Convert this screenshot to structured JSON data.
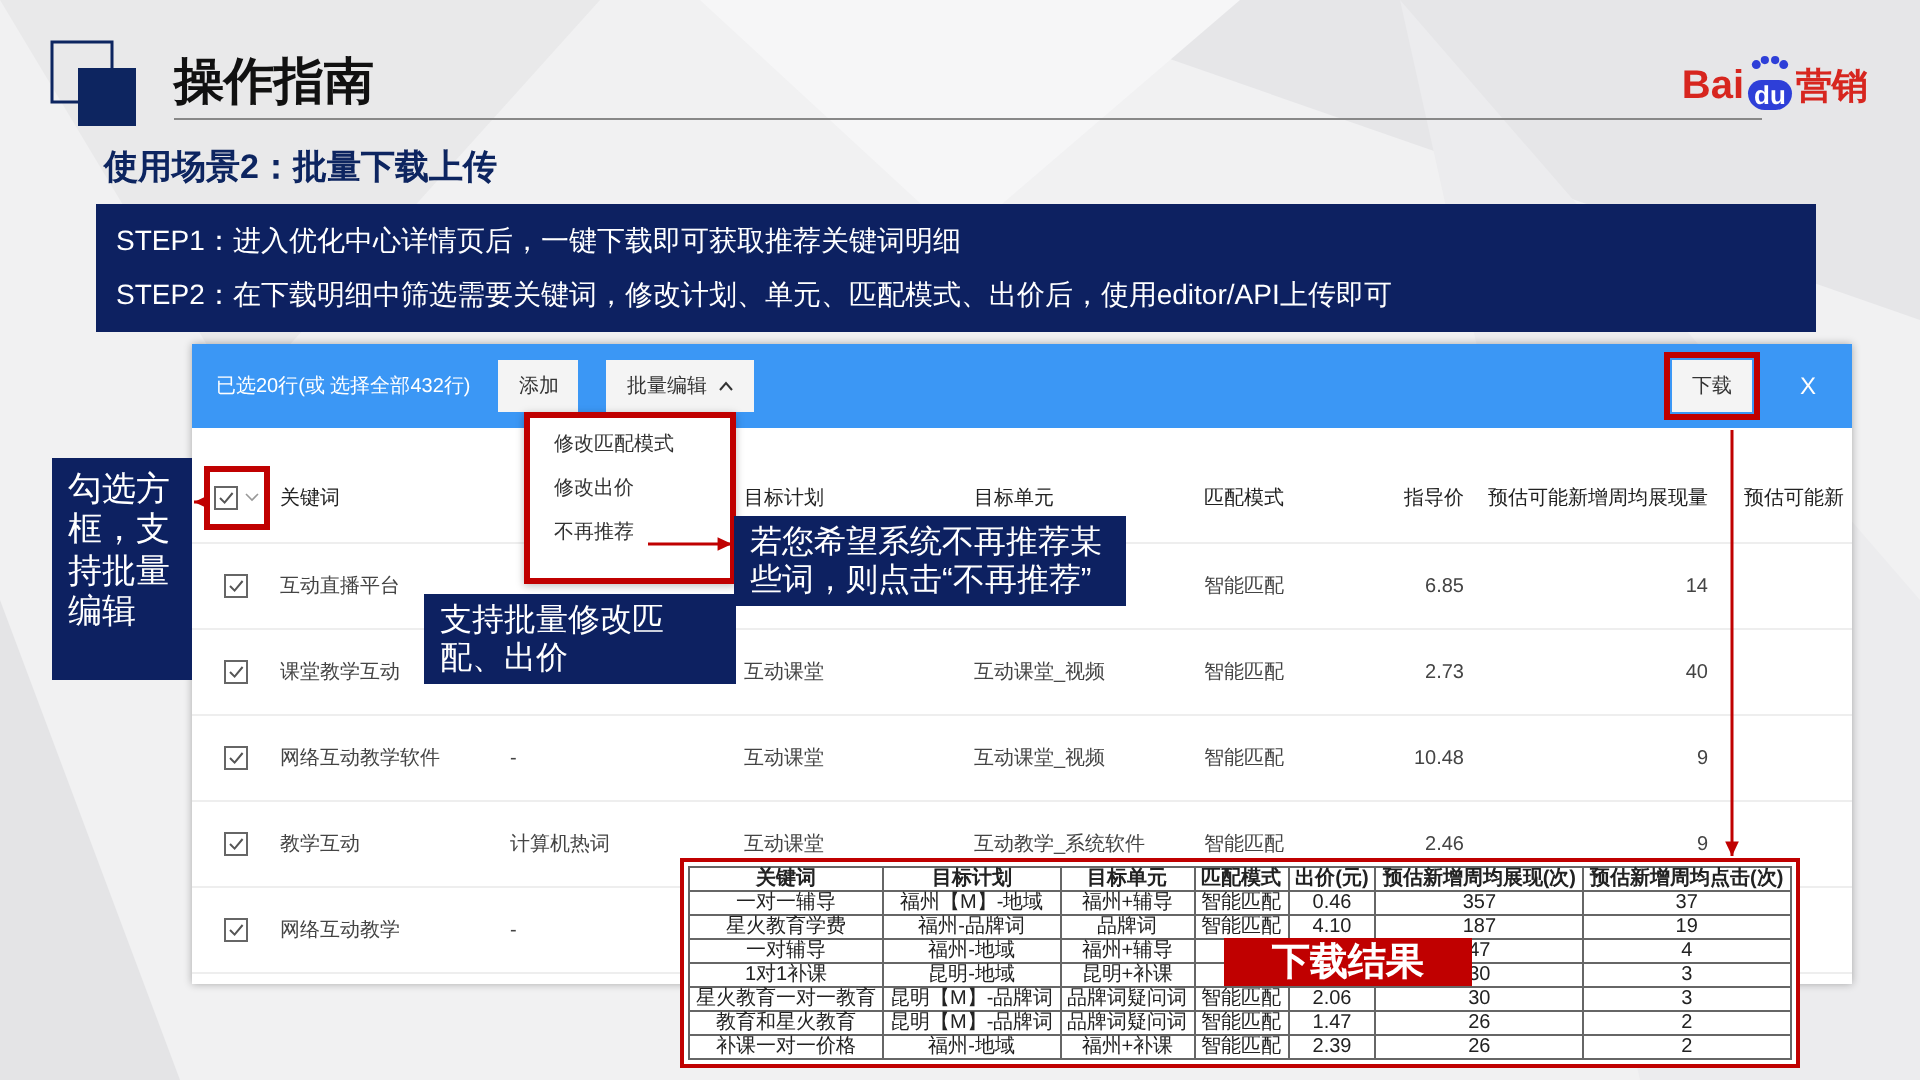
{
  "header": {
    "title": "操作指南",
    "logo": {
      "left": "Bai",
      "paw": "du",
      "right": "营销"
    }
  },
  "subtitle": "使用场景2：批量下载上传",
  "steps": [
    "STEP1：进入优化中心详情页后，一键下载即可获取推荐关键词明细",
    "STEP2：在下载明细中筛选需要关键词，修改计划、单元、匹配模式、出价后，使用editor/API上传即可"
  ],
  "app": {
    "toolbar": {
      "selection": "已选20行(或 选择全部432行)",
      "buttons": [
        {
          "label": "添加",
          "kind": "plain"
        },
        {
          "label": "批量编辑",
          "kind": "dropdown",
          "expanded": true
        }
      ],
      "download": "下载",
      "close": "X"
    },
    "menu": [
      "修改匹配模式",
      "修改出价",
      "不再推荐"
    ],
    "table": {
      "all_checked": true,
      "columns": [
        "关键词",
        null,
        "目标计划",
        "目标单元",
        "匹配模式",
        "指导价",
        "预估可能新增周均展现量",
        "预估可能新"
      ],
      "rows": [
        {
          "checked": true,
          "cells": [
            "互动直播平台",
            null,
            null,
            null,
            "智能匹配",
            "6.85",
            "14",
            null
          ]
        },
        {
          "checked": true,
          "cells": [
            "课堂教学互动",
            null,
            "互动课堂",
            "互动课堂_视频",
            "智能匹配",
            "2.73",
            "40",
            null
          ]
        },
        {
          "checked": true,
          "cells": [
            "网络互动教学软件",
            "-",
            "互动课堂",
            "互动课堂_视频",
            "智能匹配",
            "10.48",
            "9",
            null
          ]
        },
        {
          "checked": true,
          "cells": [
            "教学互动",
            "计算机热词",
            "互动课堂",
            "互动教学_系统软件",
            "智能匹配",
            "2.46",
            "9",
            null
          ]
        },
        {
          "checked": true,
          "cells": [
            "网络互动教学",
            "-",
            null,
            null,
            null,
            null,
            null,
            null
          ]
        }
      ]
    }
  },
  "callouts": [
    {
      "kind": "checkbox",
      "text": "勾选方框，支持批量编辑"
    },
    {
      "kind": "menu",
      "text": "支持批量修改匹配、出价"
    },
    {
      "kind": "remove",
      "text": "若您希望系统不再推荐某些词，则点击“不再推荐”"
    }
  ],
  "result": {
    "label": "下载结果",
    "columns": [
      "关键词",
      "目标计划",
      "目标单元",
      "匹配模式",
      "出价(元)",
      "预估新增周均展现(次)",
      "预估新增周均点击(次)"
    ],
    "rows": [
      [
        "一对一辅导",
        "福州【M】-地域",
        "福州+辅导",
        "智能匹配",
        "0.46",
        "357",
        "37"
      ],
      [
        "星火教育学费",
        "福州-品牌词",
        "品牌词",
        "智能匹配",
        "4.10",
        "187",
        "19"
      ],
      [
        "一对辅导",
        "福州-地域",
        "福州+辅导",
        null,
        null,
        "47",
        "4"
      ],
      [
        "1对1补课",
        "昆明-地域",
        "昆明+补课",
        null,
        null,
        "30",
        "3"
      ],
      [
        "星火教育一对一教育",
        "昆明【M】-品牌词",
        "品牌词疑问词",
        "智能匹配",
        "2.06",
        "30",
        "3"
      ],
      [
        "教育和星火教育",
        "昆明【M】-品牌词",
        "品牌词疑问词",
        "智能匹配",
        "1.47",
        "26",
        "2"
      ],
      [
        "补课一对一价格",
        "福州-地域",
        "福州+补课",
        "智能匹配",
        "2.39",
        "26",
        "2"
      ]
    ]
  }
}
